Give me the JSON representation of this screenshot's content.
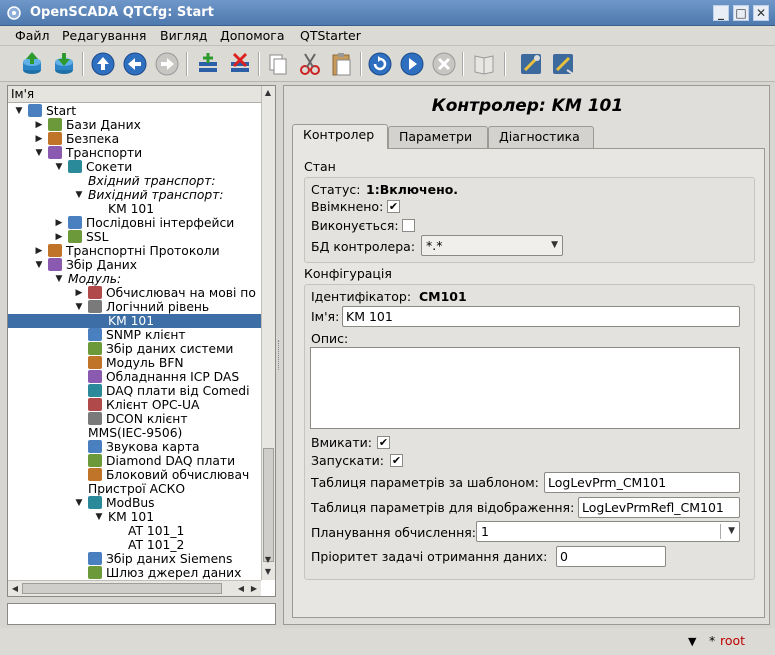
{
  "window": {
    "title": "OpenSCADA QTCfg: Start",
    "min": "_",
    "max": "□",
    "close": "✕"
  },
  "menu": [
    "Файл",
    "Редагування",
    "Вигляд",
    "Допомога",
    "QTStarter"
  ],
  "tree": {
    "header": "Ім'я",
    "rows": [
      {
        "label": "Start",
        "depth": 0,
        "arrow": "down",
        "icon": "start-icon",
        "italic": false
      },
      {
        "label": "Бази Даних",
        "depth": 1,
        "arrow": "right",
        "icon": "database-icon",
        "italic": false
      },
      {
        "label": "Безпека",
        "depth": 1,
        "arrow": "right",
        "icon": "security-icon",
        "italic": false
      },
      {
        "label": "Транспорти",
        "depth": 1,
        "arrow": "down",
        "icon": "transport-icon",
        "italic": false
      },
      {
        "label": "Сокети",
        "depth": 2,
        "arrow": "down",
        "icon": "socket-icon",
        "italic": false
      },
      {
        "label": "Вхідний транспорт:",
        "depth": 3,
        "arrow": "",
        "icon": "",
        "italic": true
      },
      {
        "label": "Вихідний транспорт:",
        "depth": 3,
        "arrow": "down",
        "icon": "",
        "italic": true
      },
      {
        "label": "KM 101",
        "depth": 4,
        "arrow": "",
        "icon": "",
        "italic": false
      },
      {
        "label": "Послідовні інтерфейси",
        "depth": 2,
        "arrow": "right",
        "icon": "serial-icon",
        "italic": false
      },
      {
        "label": "SSL",
        "depth": 2,
        "arrow": "right",
        "icon": "ssl-icon",
        "italic": false
      },
      {
        "label": "Транспортні Протоколи",
        "depth": 1,
        "arrow": "right",
        "icon": "protocol-icon",
        "italic": false
      },
      {
        "label": "Збір Даних",
        "depth": 1,
        "arrow": "down",
        "icon": "daq-icon",
        "italic": false
      },
      {
        "label": "Модуль:",
        "depth": 2,
        "arrow": "down",
        "icon": "",
        "italic": true
      },
      {
        "label": "Обчислювач на мові по",
        "depth": 3,
        "arrow": "right",
        "icon": "java-like-icon",
        "italic": false
      },
      {
        "label": "Логічний рівень",
        "depth": 3,
        "arrow": "down",
        "icon": "logic-level-icon",
        "italic": false
      },
      {
        "label": "KM 101",
        "depth": 4,
        "arrow": "",
        "icon": "",
        "italic": false,
        "selected": true
      },
      {
        "label": "SNMP клієнт",
        "depth": 3,
        "arrow": "",
        "icon": "snmp-icon",
        "italic": false
      },
      {
        "label": "Збір даних системи",
        "depth": 3,
        "arrow": "",
        "icon": "system-icon",
        "italic": false
      },
      {
        "label": "Модуль BFN",
        "depth": 3,
        "arrow": "",
        "icon": "bfn-icon",
        "italic": false
      },
      {
        "label": "Обладнання ICP DAS",
        "depth": 3,
        "arrow": "",
        "icon": "icpdas-icon",
        "italic": false
      },
      {
        "label": "DAQ плати від Comedi",
        "depth": 3,
        "arrow": "",
        "icon": "comedi-icon",
        "italic": false
      },
      {
        "label": "Клієнт OPC-UA",
        "depth": 3,
        "arrow": "",
        "icon": "opcua-icon",
        "italic": false
      },
      {
        "label": "DCON клієнт",
        "depth": 3,
        "arrow": "",
        "icon": "dcon-icon",
        "italic": false
      },
      {
        "label": "MMS(IEC-9506)",
        "depth": 3,
        "arrow": "",
        "icon": "",
        "italic": false,
        "noIndentIcon": true
      },
      {
        "label": "Звукова карта",
        "depth": 3,
        "arrow": "",
        "icon": "soundcard-icon",
        "italic": false
      },
      {
        "label": "Diamond DAQ плати",
        "depth": 3,
        "arrow": "",
        "icon": "diamond-icon",
        "italic": false
      },
      {
        "label": "Блоковий обчислювач",
        "depth": 3,
        "arrow": "",
        "icon": "block-calc-icon",
        "italic": false
      },
      {
        "label": "Пристрої АСКО",
        "depth": 3,
        "arrow": "",
        "icon": "",
        "italic": false,
        "noIndentIcon": true
      },
      {
        "label": "ModBus",
        "depth": 3,
        "arrow": "down",
        "icon": "modbus-icon",
        "italic": false
      },
      {
        "label": "KM 101",
        "depth": 4,
        "arrow": "down",
        "icon": "",
        "italic": false
      },
      {
        "label": "AT 101_1",
        "depth": 5,
        "arrow": "",
        "icon": "",
        "italic": false
      },
      {
        "label": "AT 101_2",
        "depth": 5,
        "arrow": "",
        "icon": "",
        "italic": false
      },
      {
        "label": "Збір даних Siemens",
        "depth": 3,
        "arrow": "",
        "icon": "siemens-icon",
        "italic": false
      },
      {
        "label": "Шлюз джерел даних",
        "depth": 3,
        "arrow": "",
        "icon": "gateway-icon",
        "italic": false
      }
    ]
  },
  "page": {
    "title": "Контролер: KM 101",
    "tabs": [
      "Контролер",
      "Параметри",
      "Діагностика"
    ],
    "state": {
      "group_title": "Стан",
      "status_label": "Статус:",
      "status_value": "1:Включено.",
      "enabled_label": "Ввімкнено:",
      "running_label": "Виконується:",
      "db_label": "БД контролера:",
      "db_value": "*.*"
    },
    "config": {
      "group_title": "Конфігурація",
      "id_label": "Ідентифікатор:",
      "id_value": "CM101",
      "name_label": "Ім'я:",
      "name_value": "KM 101",
      "descr_label": "Опис:",
      "enable_label": "Вмикати:",
      "start_label": "Запускати:",
      "prm_tmpl_label": "Таблиця параметрів за шаблоном:",
      "prm_tmpl_value": "LogLevPrm_CM101",
      "prm_refl_label": "Таблиця параметрів для відображення:",
      "prm_refl_value": "LogLevPrmRefl_CM101",
      "sched_label": "Планування обчислення:",
      "sched_value": "1",
      "prior_label": "Пріоритет задачі отримання даних:",
      "prior_value": "0"
    }
  },
  "status": {
    "modified": "*",
    "user": "root"
  }
}
